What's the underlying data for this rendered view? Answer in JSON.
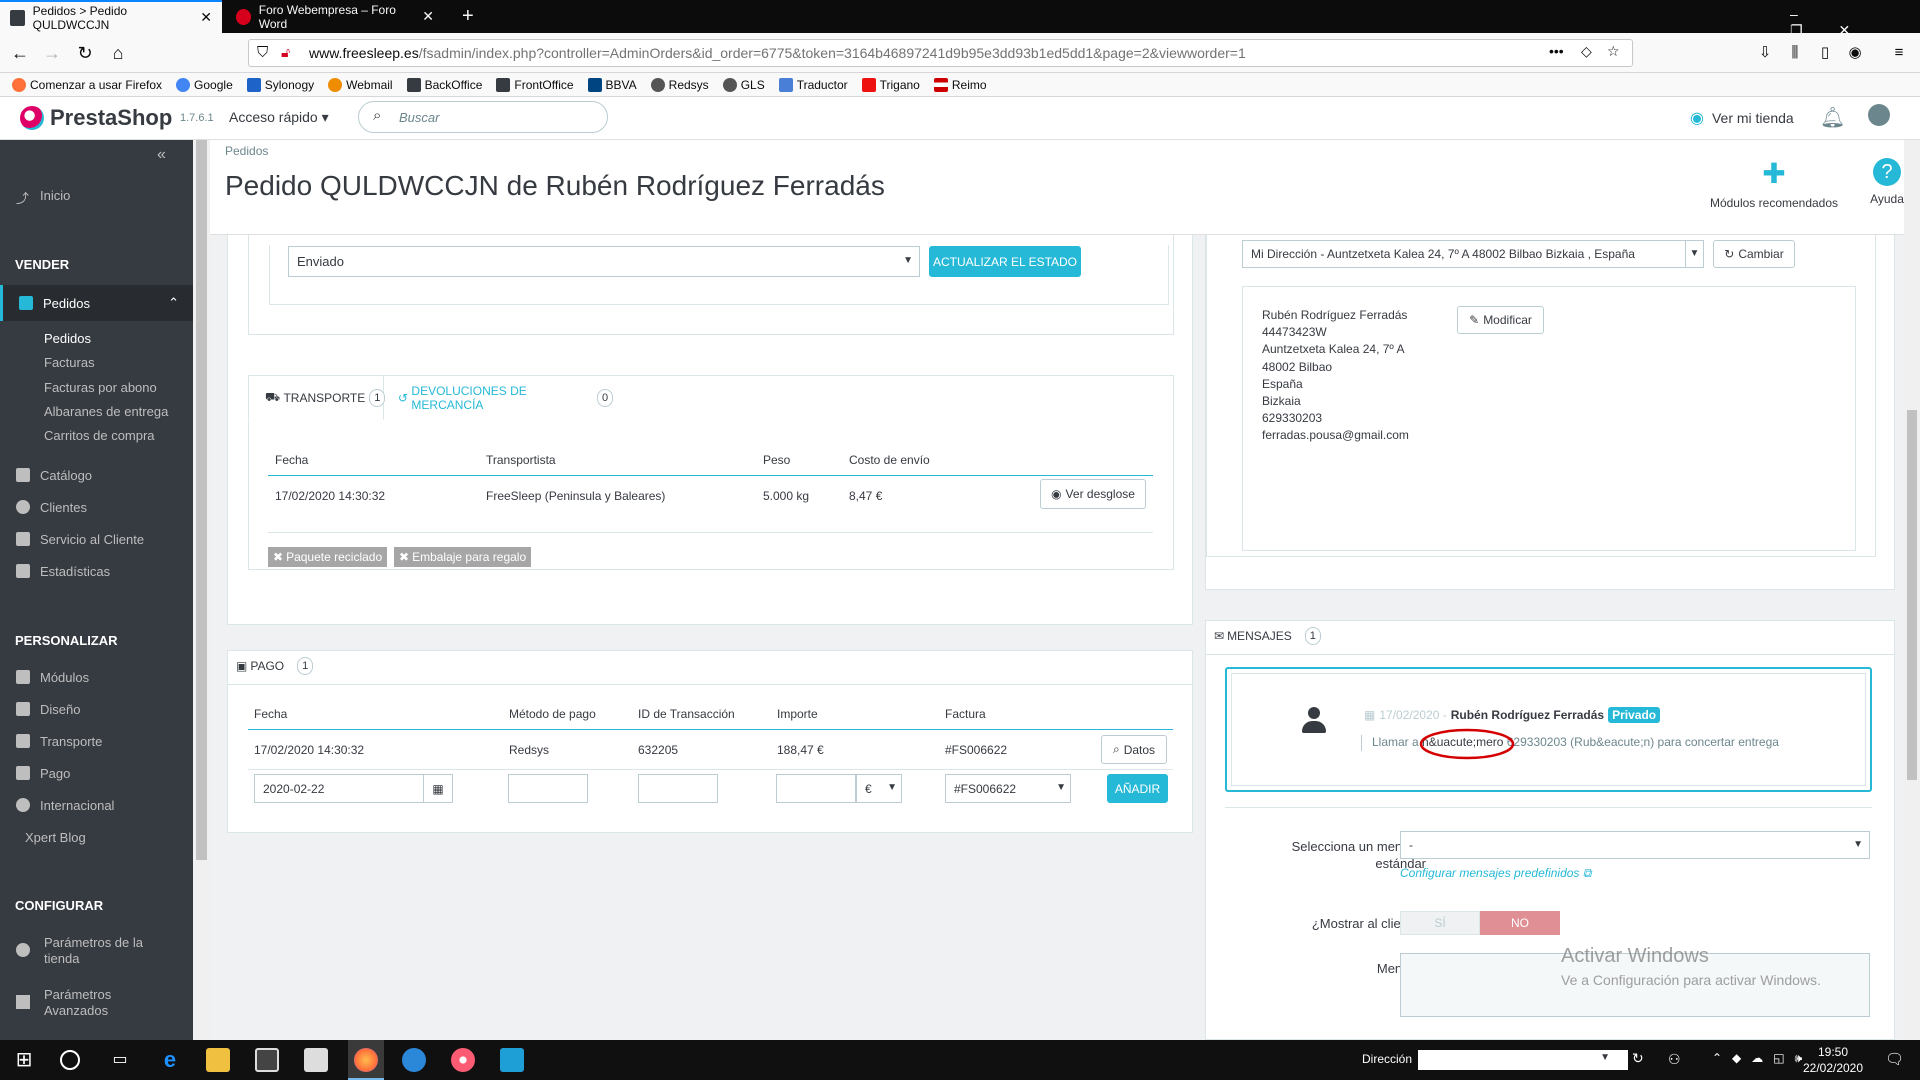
{
  "browser": {
    "tabs": [
      {
        "title": "Pedidos > Pedido QULDWCCJN",
        "active": true
      },
      {
        "title": "Foro Webempresa – Foro Word",
        "active": false
      }
    ],
    "new_tab": "+",
    "url_domain": "www.freesleep.es",
    "url_path": "/fsadmin/index.php?controller=AdminOrders&id_order=6775&token=3164b46897241d9b95e3dd93b1ed5dd1&page=2&viewworder=1",
    "url_more": "•••",
    "bookmarks": [
      "Comenzar a usar Firefox",
      "Google",
      "Sylonogy",
      "Webmail",
      "BackOffice",
      "FrontOffice",
      "BBVA",
      "Redsys",
      "GLS",
      "Traductor",
      "Trigano",
      "Reimo"
    ]
  },
  "ps_header": {
    "brand": "PrestaShop",
    "version": "1.7.6.1",
    "quick_access": "Acceso rápido",
    "search_placeholder": "Buscar",
    "view_store": "Ver mi tienda"
  },
  "sidebar": {
    "collapse": "«",
    "home": "Inicio",
    "sell_header": "VENDER",
    "orders": "Pedidos",
    "orders_sub": [
      "Pedidos",
      "Facturas",
      "Facturas por abono",
      "Albaranes de entrega",
      "Carritos de compra"
    ],
    "catalog": "Catálogo",
    "clients": "Clientes",
    "customer_service": "Servicio al Cliente",
    "stats": "Estadísticas",
    "customize_header": "PERSONALIZAR",
    "modules": "Módulos",
    "design": "Diseño",
    "shipping": "Transporte",
    "payment": "Pago",
    "international": "Internacional",
    "xpert_blog": "Xpert Blog",
    "configure_header": "CONFIGURAR",
    "shop_params_1": "Parámetros de la",
    "shop_params_2": "tienda",
    "adv_params_1": "Parámetros",
    "adv_params_2": "Avanzados"
  },
  "page": {
    "breadcrumb": "Pedidos",
    "title": "Pedido QULDWCCJN de Rubén Rodríguez Ferradás",
    "recommended_modules": "Módulos recomendados",
    "help": "Ayuda"
  },
  "status": {
    "current": "Enviado",
    "update_button": "ACTUALIZAR EL ESTADO"
  },
  "shipping_tabs": {
    "transport_label": "TRANSPORTE",
    "transport_count": "1",
    "returns_label": "DEVOLUCIONES DE MERCANCÍA",
    "returns_count": "0",
    "columns": [
      "Fecha",
      "Transportista",
      "Peso",
      "Costo de envío"
    ],
    "row": {
      "date": "17/02/2020 14:30:32",
      "carrier": "FreeSleep (Peninsula y Baleares)",
      "weight": "5.000 kg",
      "cost": "8,47 €"
    },
    "detail_button": "Ver desglose",
    "recycled": "Paquete reciclado",
    "gift": "Embalaje para regalo"
  },
  "payment": {
    "title": "PAGO",
    "count": "1",
    "columns": [
      "Fecha",
      "Método de pago",
      "ID de Transacción",
      "Importe",
      "Factura"
    ],
    "row": {
      "date": "17/02/2020 14:30:32",
      "method": "Redsys",
      "txn": "632205",
      "amount": "188,47 €",
      "invoice": "#FS006622"
    },
    "details_button": "Datos",
    "new_date": "2020-02-22",
    "currency": "€",
    "invoice_select": "#FS006622",
    "add_button": "AÑADIR"
  },
  "address": {
    "select": "Mi Dirección - Auntzetxeta Kalea 24, 7º A 48002 Bilbao Bizkaia , España",
    "change_button": "Cambiar",
    "modify_button": "Modificar",
    "lines": [
      "Rubén Rodríguez Ferradás",
      "44473423W",
      "Auntzetxeta Kalea 24, 7º A",
      "48002 Bilbao",
      "España",
      "Bizkaia",
      "629330203",
      "ferradas.pousa@gmail.com"
    ]
  },
  "messages": {
    "title": "MENSAJES",
    "count": "1",
    "msg_date": "17/02/2020 -",
    "msg_author": "Rubén Rodríguez Ferradás",
    "msg_badge": "Privado",
    "msg_text_a": "Llamar a ",
    "msg_text_b": "n&uacute;mero",
    "msg_text_c": " 629330203 (Rub&eacute;n) para concertar entrega",
    "std_label_1": "Selecciona un mensaje",
    "std_label_2": "estándar",
    "std_value": "-",
    "config_link": "Configurar mensajes predefinidos",
    "show_label": "¿Mostrar al cliente?",
    "yes": "SÍ",
    "no": "NO",
    "message_label": "Mensaje"
  },
  "watermark": {
    "line1": "Activar Windows",
    "line2": "Ve a Configuración para activar Windows."
  },
  "taskbar": {
    "address_label": "Dirección",
    "time": "19:50",
    "date": "22/02/2020"
  },
  "colors": {
    "accent": "#25b9d7",
    "sidebar": "#363a41",
    "danger": "#e08f95",
    "annotation": "#d40000"
  }
}
